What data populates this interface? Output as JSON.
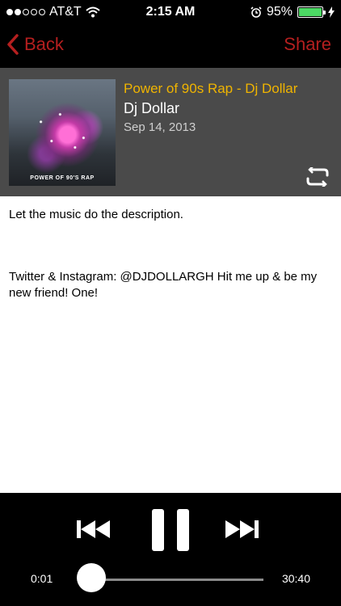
{
  "status_bar": {
    "carrier": "AT&T",
    "time": "2:15 AM",
    "battery_percent": "95%",
    "signal_bars_filled": 2,
    "signal_bars_total": 5,
    "battery_level": 0.95
  },
  "nav": {
    "back_label": "Back",
    "share_label": "Share",
    "accent_color": "#b51f1f"
  },
  "episode": {
    "title": "Power of 90s Rap - Dj Dollar",
    "artist": "Dj Dollar",
    "date": "Sep 14, 2013",
    "artwork_caption": "POWER OF 90'S RAP",
    "title_color": "#f0b400"
  },
  "description": {
    "paragraph1": "Let the music do the description.",
    "paragraph2": "Twitter & Instagram: @DJDOLLARGH Hit me up & be my new friend! One!"
  },
  "player": {
    "elapsed": "0:01",
    "duration": "30:40",
    "progress": 0.0005,
    "icons": [
      "previous-track-icon",
      "pause-icon",
      "next-track-icon",
      "repeat-icon"
    ]
  }
}
